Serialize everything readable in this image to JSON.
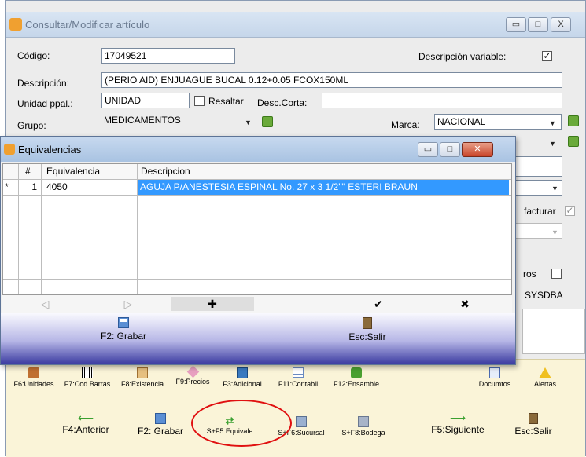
{
  "main_window": {
    "title": "Consultar/Modificar artículo",
    "controls": {
      "minimize": "▭",
      "maximize": "□",
      "close": "X"
    },
    "fields": {
      "codigo_label": "Código:",
      "codigo_value": "17049521",
      "descripcion_variable_label": "Descripción variable:",
      "descripcion_variable_checked": "✓",
      "descripcion_label": "Descripción:",
      "descripcion_value": "(PERIO AID) ENJUAGUE BUCAL 0.12+0.05 FCOX150ML",
      "unidad_label": "Unidad ppal.:",
      "unidad_value": "UNIDAD",
      "resaltar_label": "Resaltar",
      "desc_corta_label": "Desc.Corta:",
      "desc_corta_value": "",
      "grupo_label": "Grupo:",
      "grupo_value": "MEDICAMENTOS",
      "marca_label": "Marca:",
      "marca_value": "NACIONAL",
      "facturar_label": "facturar",
      "facturar_checked": "✓",
      "ros_label": "ros",
      "user_text": "SYSDBA"
    }
  },
  "dialog": {
    "title": "Equivalencias",
    "controls": {
      "minimize": "▭",
      "maximize": "□",
      "close": "✕"
    },
    "columns": [
      "#",
      "Equivalencia",
      "Descripcion"
    ],
    "rows": [
      {
        "marker": "*",
        "num": "1",
        "equivalencia": "4050",
        "descripcion": "AGUJA P/ANESTESIA ESPINAL No. 27 x 3 1/2\"\" ESTERI BRAUN"
      }
    ],
    "nav": {
      "prior": "◁",
      "next": "▷",
      "insert": "✚",
      "delete": "—",
      "post": "✔",
      "cancel": "✖"
    },
    "footer": {
      "save_label": "F2: Grabar",
      "exit_label": "Esc:Salir"
    }
  },
  "toolbar": {
    "row1": [
      {
        "label": "F6:Unidades",
        "icon": "box-icon"
      },
      {
        "label": "F7:Cod.Barras",
        "icon": "barcode-icon"
      },
      {
        "label": "F8:Existencia",
        "icon": "clipboard-icon"
      },
      {
        "label": "F9:Precios",
        "icon": "price-tag-icon"
      },
      {
        "label": "F3:Adicional",
        "icon": "window-icon"
      },
      {
        "label": "F11:Contabil",
        "icon": "spreadsheet-icon"
      },
      {
        "label": "F12:Ensamble",
        "icon": "puzzle-icon"
      },
      {
        "label": "Documtos",
        "icon": "document-icon"
      },
      {
        "label": "Alertas",
        "icon": "warning-icon"
      }
    ],
    "row2": [
      {
        "label": "F4:Anterior",
        "icon": "arrow-left-icon"
      },
      {
        "label": "F2: Grabar",
        "icon": "save-icon"
      },
      {
        "label": "S+F5:Equivale",
        "icon": "shuffle-icon"
      },
      {
        "label": "S+F6:Sucursal",
        "icon": "branch-icon"
      },
      {
        "label": "S+F8:Bodega",
        "icon": "warehouse-icon"
      },
      {
        "label": "F5:Siguiente",
        "icon": "arrow-right-icon"
      },
      {
        "label": "Esc:Salir",
        "icon": "door-icon"
      }
    ]
  },
  "colors": {
    "selection": "#3399ff",
    "highlight_ring": "#e01010",
    "toolbar_bg": "#faf4d8"
  }
}
